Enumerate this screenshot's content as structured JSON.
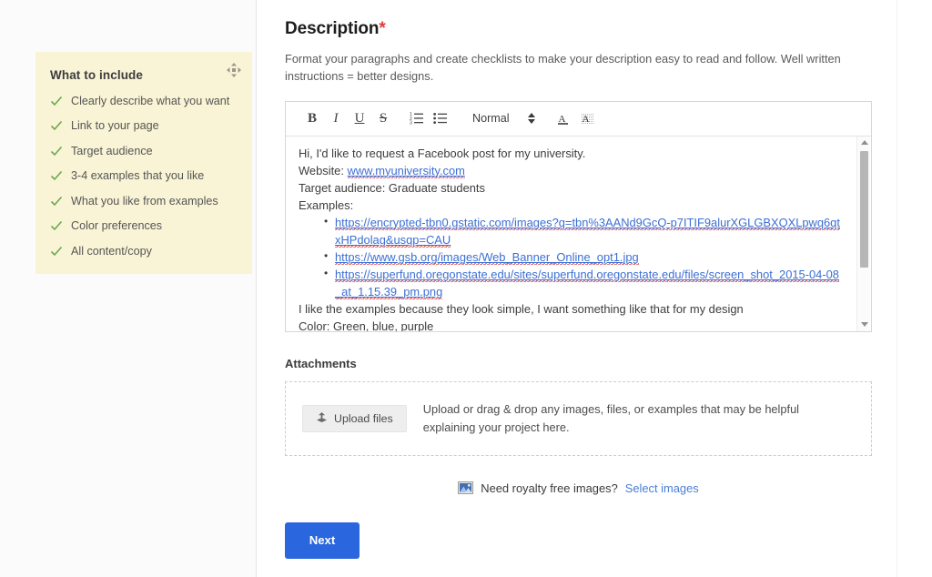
{
  "tip_card": {
    "title": "What to include",
    "drag_handle_icon": "move-handle-icon",
    "check_icon": "check-icon",
    "items": [
      "Clearly describe what you want",
      "Link to your page",
      "Target audience",
      "3-4 examples that you like",
      "What you like from examples",
      "Color preferences",
      "All content/copy"
    ]
  },
  "description": {
    "title": "Description",
    "required_marker": "*",
    "helper_text": "Format your paragraphs and create checklists to make your description easy to read and follow. Well written instructions = better designs."
  },
  "editor": {
    "toolbar": {
      "bold": "B",
      "italic": "I",
      "underline": "U",
      "strikethrough": "S",
      "ordered_list_icon": "ordered-list-icon",
      "bullet_list_icon": "bullet-list-icon",
      "style_value": "Normal",
      "stepper_icon": "stepper-updown-icon",
      "text_color_icon": "text-color-icon",
      "highlight_icon": "text-highlight-icon"
    },
    "content": {
      "line1": "Hi, I'd like to request a Facebook post for my university.",
      "line2_label": "Website: ",
      "line2_value": "www.myuniversity.com",
      "line3": "Target audience: Graduate students",
      "line4": "Examples:",
      "links": [
        "https://encrypted-tbn0.gstatic.com/images?q=tbn%3AANd9GcQ-p7ITIF9alurXGLGBXQXLpwq6qtxHPdolag&usqp=CAU",
        "https://www.gsb.org/images/Web_Banner_Online_opt1.jpg",
        "https://superfund.oregonstate.edu/sites/superfund.oregonstate.edu/files/screen_shot_2015-04-08_at_1.15.39_pm.png"
      ],
      "line5": "I like the examples because they look simple, I want something like that for my design",
      "line6": "Color: Green, blue, purple"
    },
    "scrollbar": {
      "up_icon": "scroll-up-arrow-icon",
      "down_icon": "scroll-down-arrow-icon"
    }
  },
  "attachments": {
    "title": "Attachments",
    "upload_button_label": "Upload files",
    "upload_icon": "upload-icon",
    "dropzone_text": "Upload or drag & drop any images, files, or examples that may be helpful explaining your project here."
  },
  "royalty": {
    "image_icon": "picture-icon",
    "question": "Need royalty free images?",
    "link_label": "Select images"
  },
  "footer": {
    "next_label": "Next"
  },
  "colors": {
    "tip_card_bg": "#f9f4d6",
    "check_green": "#6aa84f",
    "link_blue": "#3b6fd4",
    "accent_blue": "#2a66dd",
    "required_red": "#e03a3a",
    "spellcheck_red": "#e04b4b"
  }
}
